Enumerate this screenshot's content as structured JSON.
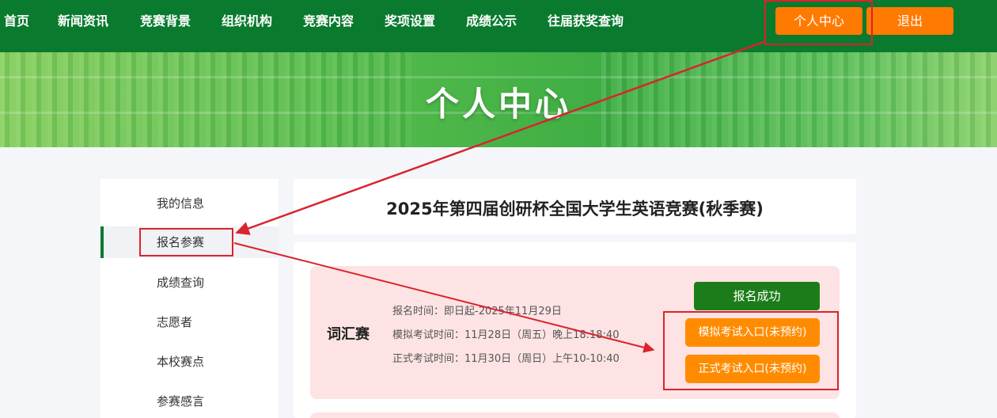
{
  "nav": {
    "items": [
      "首页",
      "新闻资讯",
      "竞赛背景",
      "组织机构",
      "竞赛内容",
      "奖项设置",
      "成绩公示",
      "往届获奖查询"
    ],
    "profile_label": "个人中心",
    "logout_label": "退出"
  },
  "banner": {
    "title": "个人中心"
  },
  "sidebar": {
    "items": [
      "我的信息",
      "报名参赛",
      "成绩查询",
      "志愿者",
      "本校赛点",
      "参赛感言"
    ],
    "active": "报名参赛"
  },
  "main": {
    "title": "2025年第四届创研杯全国大学生英语竞赛(秋季赛)",
    "competition": {
      "name": "词汇赛",
      "registration_time": "报名时间：即日起-2025年11月29日",
      "mock_exam_time": "模拟考试时间：11月28日（周五）晚上18:18:40",
      "formal_exam_time": "正式考试时间：11月30日（周日）上午10-10:40",
      "status_label": "报名成功",
      "mock_entry_label": "模拟考试入口(未预约)",
      "formal_entry_label": "正式考试入口(未预约)"
    }
  },
  "colors": {
    "nav_bg": "#0a7a2e",
    "accent_orange": "#ff7a00",
    "success_green": "#1d7c1a",
    "card_pink": "#fde3e3",
    "annotation_red": "#d9232d"
  }
}
